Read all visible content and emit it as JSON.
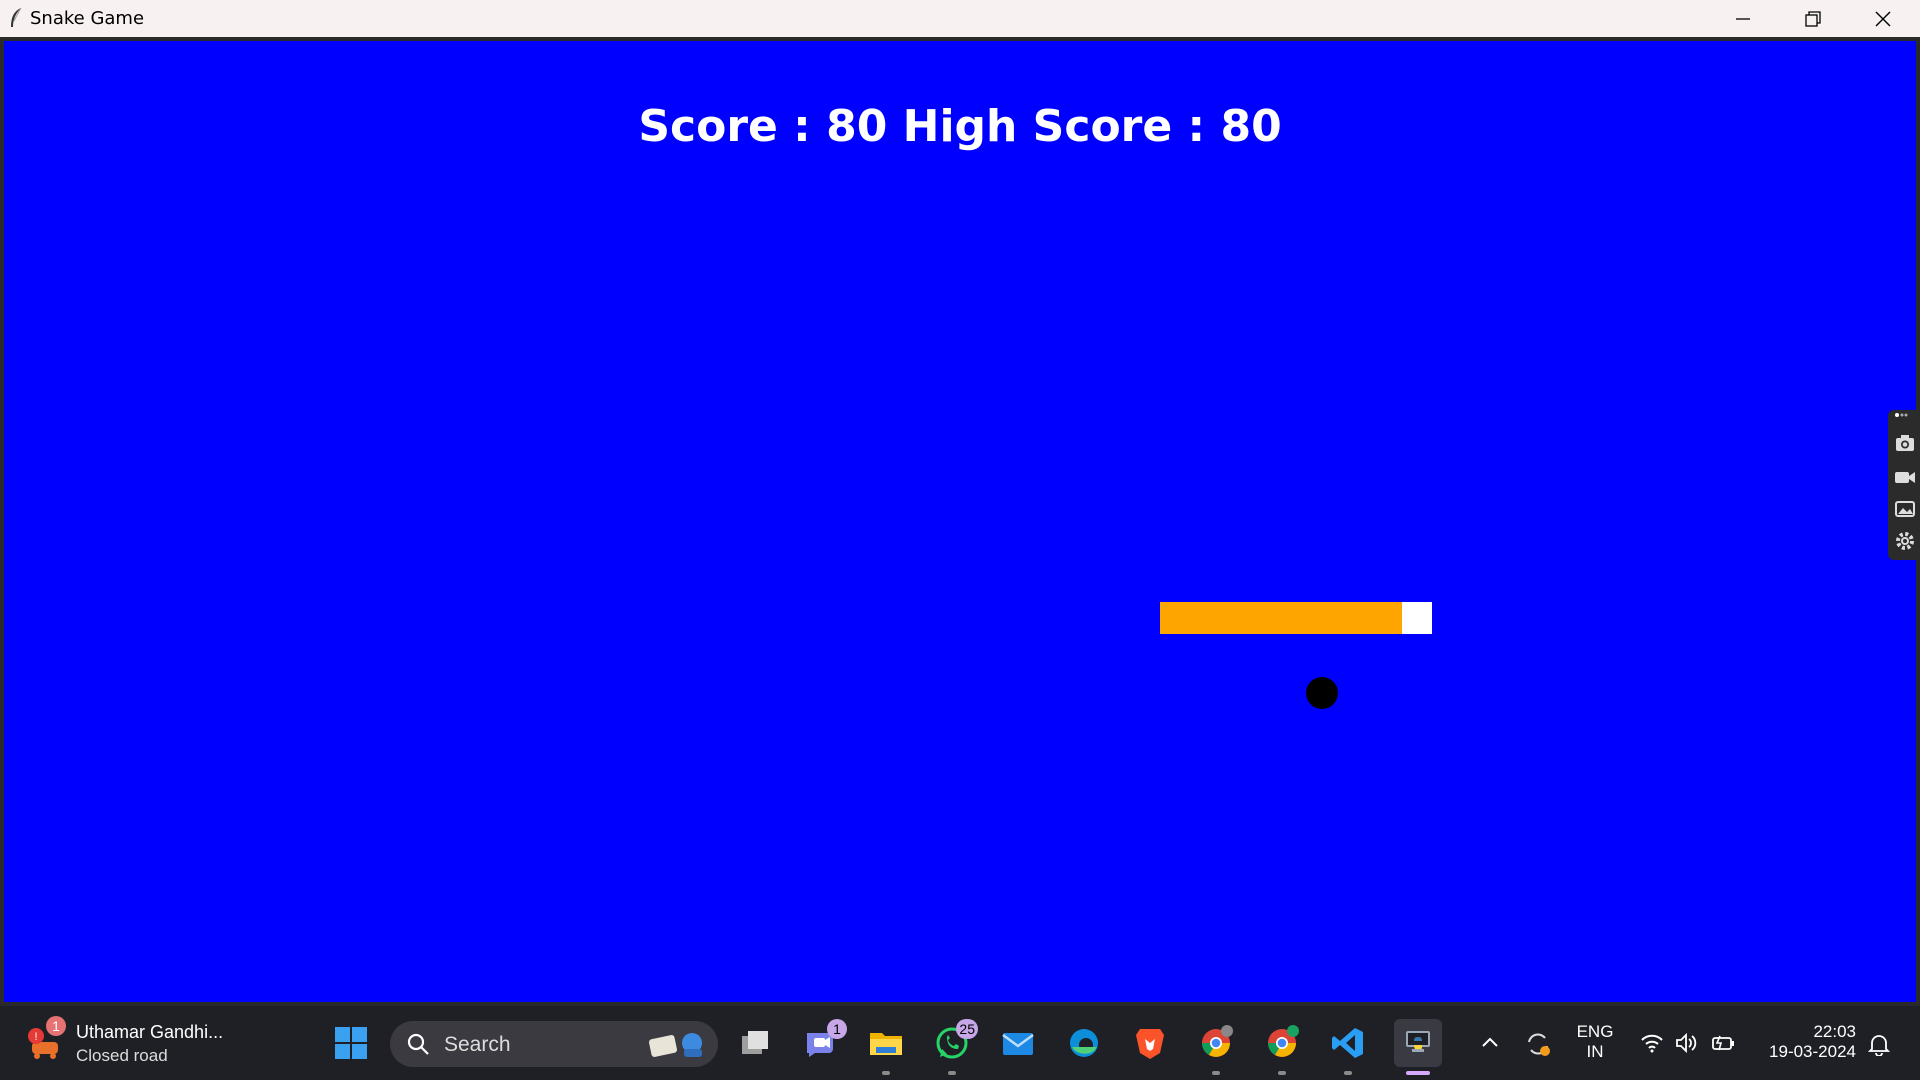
{
  "window": {
    "title": "Snake Game"
  },
  "game": {
    "score_text": "Score : 80 High Score : 80",
    "background_color": "#0000ff",
    "snake_body_color": "#ffa500",
    "snake_head_color": "#ffffff",
    "food_color": "#000000"
  },
  "capture_toolbar": {
    "icons": [
      "camera-icon",
      "video-icon",
      "gallery-icon",
      "settings-icon"
    ]
  },
  "taskbar": {
    "weather": {
      "title": "Uthamar Gandhi...",
      "subtitle": "Closed road",
      "badge": "1"
    },
    "search_label": "Search",
    "apps": [
      {
        "name": "task-view-icon",
        "badge": ""
      },
      {
        "name": "teams-icon",
        "badge": "1"
      },
      {
        "name": "file-explorer-icon",
        "badge": ""
      },
      {
        "name": "whatsapp-icon",
        "badge": "25"
      },
      {
        "name": "mail-icon",
        "badge": ""
      },
      {
        "name": "edge-icon",
        "badge": ""
      },
      {
        "name": "brave-icon",
        "badge": ""
      },
      {
        "name": "chrome-icon",
        "badge": ""
      },
      {
        "name": "chrome-profile-icon",
        "badge": ""
      },
      {
        "name": "vscode-icon",
        "badge": ""
      },
      {
        "name": "python-icon",
        "badge": ""
      }
    ],
    "language": {
      "line1": "ENG",
      "line2": "IN"
    },
    "clock": {
      "time": "22:03",
      "date": "19-03-2024"
    }
  }
}
